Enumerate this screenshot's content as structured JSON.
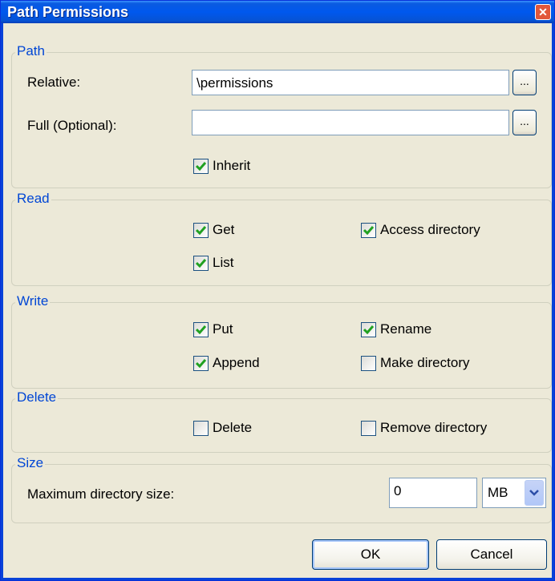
{
  "window": {
    "title": "Path Permissions",
    "close_glyph": "✕"
  },
  "path": {
    "legend": "Path",
    "relative_label": "Relative:",
    "relative_value": "\\permissions",
    "full_label": "Full (Optional):",
    "full_value": "",
    "browse_label": "...",
    "inherit": {
      "label": "Inherit",
      "checked": true
    }
  },
  "read": {
    "legend": "Read",
    "get": {
      "label": "Get",
      "checked": true
    },
    "access_directory": {
      "label": "Access directory",
      "checked": true
    },
    "list": {
      "label": "List",
      "checked": true
    }
  },
  "write": {
    "legend": "Write",
    "put": {
      "label": "Put",
      "checked": true
    },
    "rename": {
      "label": "Rename",
      "checked": true
    },
    "append": {
      "label": "Append",
      "checked": true
    },
    "make_directory": {
      "label": "Make directory",
      "checked": false
    }
  },
  "delete": {
    "legend": "Delete",
    "delete": {
      "label": "Delete",
      "checked": false
    },
    "remove_directory": {
      "label": "Remove directory",
      "checked": false
    }
  },
  "size": {
    "legend": "Size",
    "max_label": "Maximum directory size:",
    "max_value": "0",
    "unit": "MB"
  },
  "buttons": {
    "ok": "OK",
    "cancel": "Cancel"
  },
  "colors": {
    "title_bar": "#0058ee",
    "group_legend": "#0046d5",
    "checkmark": "#21a121"
  }
}
